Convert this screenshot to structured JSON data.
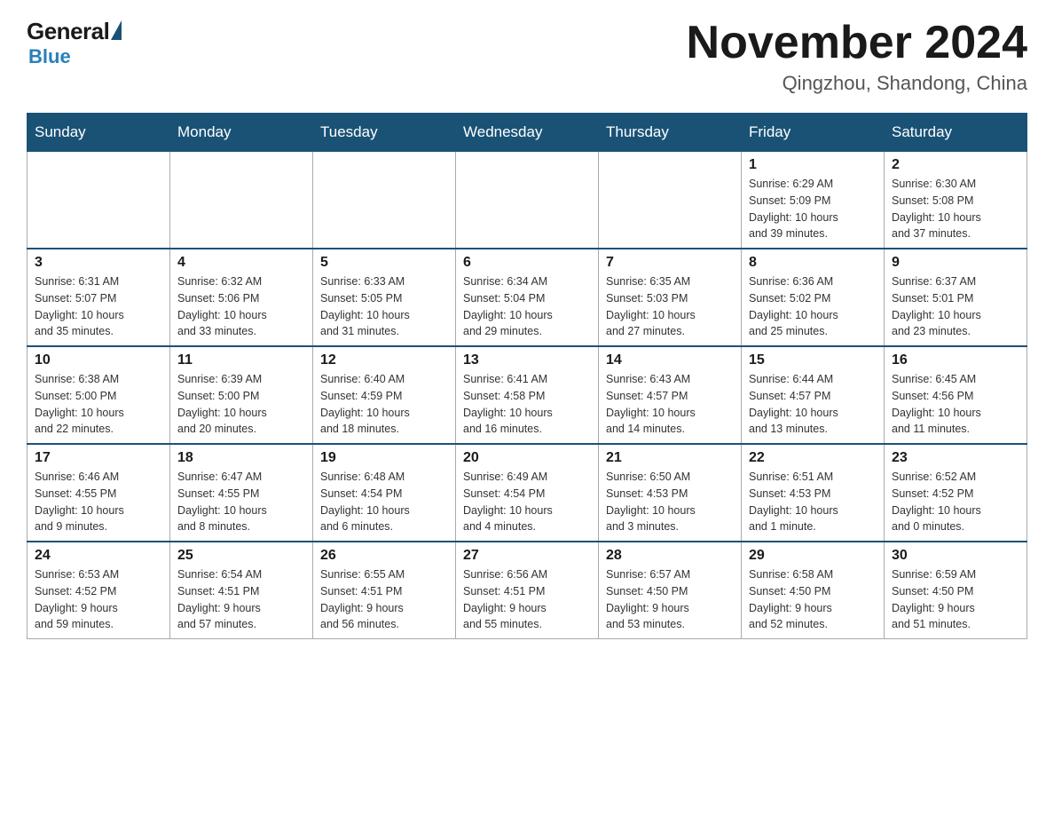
{
  "header": {
    "logo": {
      "general": "General",
      "blue": "Blue"
    },
    "title": "November 2024",
    "location": "Qingzhou, Shandong, China"
  },
  "weekdays": [
    "Sunday",
    "Monday",
    "Tuesday",
    "Wednesday",
    "Thursday",
    "Friday",
    "Saturday"
  ],
  "weeks": [
    [
      {
        "day": "",
        "info": ""
      },
      {
        "day": "",
        "info": ""
      },
      {
        "day": "",
        "info": ""
      },
      {
        "day": "",
        "info": ""
      },
      {
        "day": "",
        "info": ""
      },
      {
        "day": "1",
        "info": "Sunrise: 6:29 AM\nSunset: 5:09 PM\nDaylight: 10 hours\nand 39 minutes."
      },
      {
        "day": "2",
        "info": "Sunrise: 6:30 AM\nSunset: 5:08 PM\nDaylight: 10 hours\nand 37 minutes."
      }
    ],
    [
      {
        "day": "3",
        "info": "Sunrise: 6:31 AM\nSunset: 5:07 PM\nDaylight: 10 hours\nand 35 minutes."
      },
      {
        "day": "4",
        "info": "Sunrise: 6:32 AM\nSunset: 5:06 PM\nDaylight: 10 hours\nand 33 minutes."
      },
      {
        "day": "5",
        "info": "Sunrise: 6:33 AM\nSunset: 5:05 PM\nDaylight: 10 hours\nand 31 minutes."
      },
      {
        "day": "6",
        "info": "Sunrise: 6:34 AM\nSunset: 5:04 PM\nDaylight: 10 hours\nand 29 minutes."
      },
      {
        "day": "7",
        "info": "Sunrise: 6:35 AM\nSunset: 5:03 PM\nDaylight: 10 hours\nand 27 minutes."
      },
      {
        "day": "8",
        "info": "Sunrise: 6:36 AM\nSunset: 5:02 PM\nDaylight: 10 hours\nand 25 minutes."
      },
      {
        "day": "9",
        "info": "Sunrise: 6:37 AM\nSunset: 5:01 PM\nDaylight: 10 hours\nand 23 minutes."
      }
    ],
    [
      {
        "day": "10",
        "info": "Sunrise: 6:38 AM\nSunset: 5:00 PM\nDaylight: 10 hours\nand 22 minutes."
      },
      {
        "day": "11",
        "info": "Sunrise: 6:39 AM\nSunset: 5:00 PM\nDaylight: 10 hours\nand 20 minutes."
      },
      {
        "day": "12",
        "info": "Sunrise: 6:40 AM\nSunset: 4:59 PM\nDaylight: 10 hours\nand 18 minutes."
      },
      {
        "day": "13",
        "info": "Sunrise: 6:41 AM\nSunset: 4:58 PM\nDaylight: 10 hours\nand 16 minutes."
      },
      {
        "day": "14",
        "info": "Sunrise: 6:43 AM\nSunset: 4:57 PM\nDaylight: 10 hours\nand 14 minutes."
      },
      {
        "day": "15",
        "info": "Sunrise: 6:44 AM\nSunset: 4:57 PM\nDaylight: 10 hours\nand 13 minutes."
      },
      {
        "day": "16",
        "info": "Sunrise: 6:45 AM\nSunset: 4:56 PM\nDaylight: 10 hours\nand 11 minutes."
      }
    ],
    [
      {
        "day": "17",
        "info": "Sunrise: 6:46 AM\nSunset: 4:55 PM\nDaylight: 10 hours\nand 9 minutes."
      },
      {
        "day": "18",
        "info": "Sunrise: 6:47 AM\nSunset: 4:55 PM\nDaylight: 10 hours\nand 8 minutes."
      },
      {
        "day": "19",
        "info": "Sunrise: 6:48 AM\nSunset: 4:54 PM\nDaylight: 10 hours\nand 6 minutes."
      },
      {
        "day": "20",
        "info": "Sunrise: 6:49 AM\nSunset: 4:54 PM\nDaylight: 10 hours\nand 4 minutes."
      },
      {
        "day": "21",
        "info": "Sunrise: 6:50 AM\nSunset: 4:53 PM\nDaylight: 10 hours\nand 3 minutes."
      },
      {
        "day": "22",
        "info": "Sunrise: 6:51 AM\nSunset: 4:53 PM\nDaylight: 10 hours\nand 1 minute."
      },
      {
        "day": "23",
        "info": "Sunrise: 6:52 AM\nSunset: 4:52 PM\nDaylight: 10 hours\nand 0 minutes."
      }
    ],
    [
      {
        "day": "24",
        "info": "Sunrise: 6:53 AM\nSunset: 4:52 PM\nDaylight: 9 hours\nand 59 minutes."
      },
      {
        "day": "25",
        "info": "Sunrise: 6:54 AM\nSunset: 4:51 PM\nDaylight: 9 hours\nand 57 minutes."
      },
      {
        "day": "26",
        "info": "Sunrise: 6:55 AM\nSunset: 4:51 PM\nDaylight: 9 hours\nand 56 minutes."
      },
      {
        "day": "27",
        "info": "Sunrise: 6:56 AM\nSunset: 4:51 PM\nDaylight: 9 hours\nand 55 minutes."
      },
      {
        "day": "28",
        "info": "Sunrise: 6:57 AM\nSunset: 4:50 PM\nDaylight: 9 hours\nand 53 minutes."
      },
      {
        "day": "29",
        "info": "Sunrise: 6:58 AM\nSunset: 4:50 PM\nDaylight: 9 hours\nand 52 minutes."
      },
      {
        "day": "30",
        "info": "Sunrise: 6:59 AM\nSunset: 4:50 PM\nDaylight: 9 hours\nand 51 minutes."
      }
    ]
  ]
}
